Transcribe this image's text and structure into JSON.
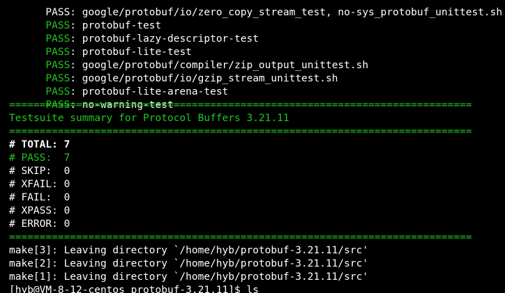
{
  "terminal": {
    "lines": [
      {
        "type": "cut",
        "text": "PASS: google/protobuf/io/zero_copy_stream_test, no-sys_protobuf_unittest.sh"
      },
      {
        "type": "pass",
        "prefix": "PASS",
        "rest": ": protobuf-test"
      },
      {
        "type": "pass",
        "prefix": "PASS",
        "rest": ": protobuf-lazy-descriptor-test"
      },
      {
        "type": "pass",
        "prefix": "PASS",
        "rest": ": protobuf-lite-test"
      },
      {
        "type": "pass",
        "prefix": "PASS",
        "rest": ": google/protobuf/compiler/zip_output_unittest.sh"
      },
      {
        "type": "pass",
        "prefix": "PASS",
        "rest": ": google/protobuf/io/gzip_stream_unittest.sh"
      },
      {
        "type": "pass",
        "prefix": "PASS",
        "rest": ": protobuf-lite-arena-test"
      },
      {
        "type": "pass",
        "prefix": "PASS",
        "rest": ": no-warning-test"
      },
      {
        "type": "sep",
        "text": "============================================================================"
      },
      {
        "type": "title",
        "text": "Testsuite summary for Protocol Buffers 3.21.11"
      },
      {
        "type": "sep",
        "text": "============================================================================"
      },
      {
        "type": "bold",
        "text": "# TOTAL: 7"
      },
      {
        "type": "green",
        "text": "# PASS:  7"
      },
      {
        "type": "plain",
        "text": "# SKIP:  0"
      },
      {
        "type": "plain",
        "text": "# XFAIL: 0"
      },
      {
        "type": "plain",
        "text": "# FAIL:  0"
      },
      {
        "type": "plain",
        "text": "# XPASS: 0"
      },
      {
        "type": "plain",
        "text": "# ERROR: 0"
      },
      {
        "type": "sep",
        "text": "============================================================================"
      },
      {
        "type": "plain",
        "text": "make[3]: Leaving directory `/home/hyb/protobuf-3.21.11/src'"
      },
      {
        "type": "plain",
        "text": "make[2]: Leaving directory `/home/hyb/protobuf-3.21.11/src'"
      },
      {
        "type": "plain",
        "text": "make[1]: Leaving directory `/home/hyb/protobuf-3.21.11/src'"
      },
      {
        "type": "prompt",
        "text": "[hyb@VM-8-12-centos protobuf-3.21.11]$ ls"
      }
    ]
  },
  "colors": {
    "background": "#000000",
    "foreground": "#ffffff",
    "green": "#23c423"
  }
}
